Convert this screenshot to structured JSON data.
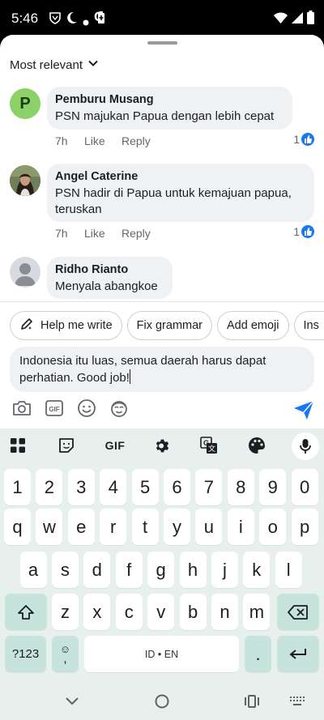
{
  "status_bar": {
    "time": "5:46",
    "left_icons": [
      "vpn-shield-icon",
      "moon-icon",
      "dot-icon",
      "google-g-icon",
      "battery-saver-icon"
    ],
    "right_icons": [
      "wifi-icon",
      "signal-icon",
      "battery-icon"
    ]
  },
  "sheet": {
    "sort_label": "Most relevant"
  },
  "comments": [
    {
      "author": "Pemburu Musang",
      "text": "PSN majukan Papua dengan lebih cepat",
      "time": "7h",
      "like_label": "Like",
      "reply_label": "Reply",
      "like_count": "1",
      "avatar_letter": "P",
      "avatar_color": "#8bd168"
    },
    {
      "author": "Angel Caterine",
      "text": "PSN hadir di Papua untuk kemajuan papua, teruskan",
      "time": "7h",
      "like_label": "Like",
      "reply_label": "Reply",
      "like_count": "1"
    },
    {
      "author": "Ridho Rianto",
      "text": "Menyala abangkoe"
    }
  ],
  "chips": {
    "help_write": "Help me write",
    "fix_grammar": "Fix grammar",
    "add_emoji": "Add emoji",
    "partial": "Ins"
  },
  "composer": {
    "value": "Indonesia itu luas, semua daerah harus dapat perhatian. Good job!"
  },
  "keyboard": {
    "toolbar_gif": "GIF",
    "row1": [
      "1",
      "2",
      "3",
      "4",
      "5",
      "6",
      "7",
      "8",
      "9",
      "0"
    ],
    "row2": [
      "q",
      "w",
      "e",
      "r",
      "t",
      "y",
      "u",
      "i",
      "o",
      "p"
    ],
    "row3": [
      "a",
      "s",
      "d",
      "f",
      "g",
      "h",
      "j",
      "k",
      "l"
    ],
    "row4": [
      "z",
      "x",
      "c",
      "v",
      "b",
      "n",
      "m"
    ],
    "symbols_key": "?123",
    "emoji_comma_bottom": ",",
    "space_label": "ID • EN",
    "period_key": ".",
    "accent_color": "#c6e3dc",
    "background": "#e8f0ee"
  },
  "colors": {
    "facebook_blue": "#1877f2",
    "bubble_bg": "#f0f1f3"
  }
}
